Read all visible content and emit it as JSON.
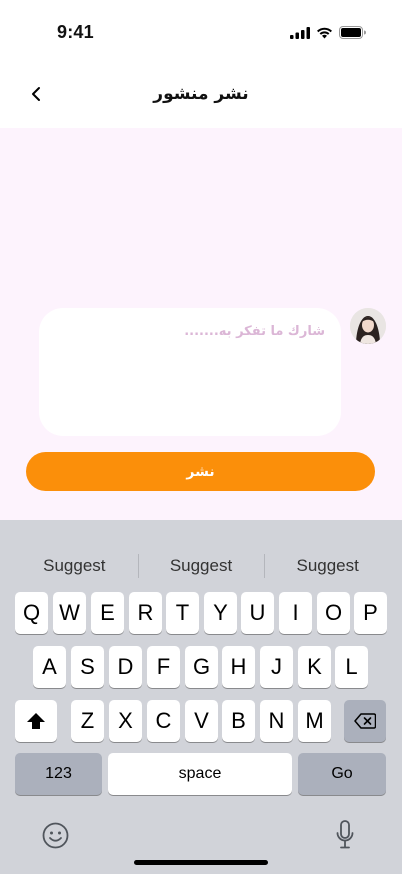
{
  "status": {
    "time": "9:41"
  },
  "header": {
    "title": "نشر منشور"
  },
  "composer": {
    "placeholder": "شارك ما تفكر به.......",
    "publish_label": "نشر"
  },
  "keyboard": {
    "suggestions": [
      "Suggest",
      "Suggest",
      "Suggest"
    ],
    "row1": [
      "Q",
      "W",
      "E",
      "R",
      "T",
      "Y",
      "U",
      "I",
      "O",
      "P"
    ],
    "row2": [
      "A",
      "S",
      "D",
      "F",
      "G",
      "H",
      "J",
      "K",
      "L"
    ],
    "row3": [
      "Z",
      "X",
      "C",
      "V",
      "B",
      "N",
      "M"
    ],
    "numbers_label": "123",
    "space_label": "space",
    "go_label": "Go"
  },
  "colors": {
    "accent": "#fb8f0a",
    "composer_bg": "#fdf3fd",
    "placeholder": "#dbb6d6",
    "keyboard_bg": "#d1d3d9"
  }
}
